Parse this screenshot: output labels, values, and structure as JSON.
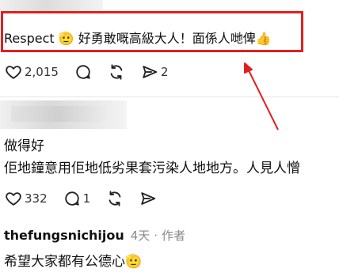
{
  "comment": {
    "text": "Respect 🫡 好勇敢嘅高級大人！面係人哋俾👍",
    "stats": {
      "likes": "2,015",
      "shares": "2"
    }
  },
  "reply": {
    "line1": "做得好",
    "line2": "佢地鐘意用佢地低劣果套污染人地地方。人見人憎",
    "stats": {
      "likes": "332",
      "comments": "1"
    }
  },
  "reply2": {
    "author": "thefungsnichijou",
    "time": "4天",
    "separator": "·",
    "tag": "作者",
    "text": "希望大家都有公德心🫡"
  },
  "icons": {
    "like": "heart-icon",
    "comment": "comment-bubble-icon",
    "repost": "repost-icon",
    "share": "send-icon"
  },
  "colors": {
    "highlight": "#e02020",
    "icon": "#222222",
    "meta": "#8a8a8a"
  }
}
